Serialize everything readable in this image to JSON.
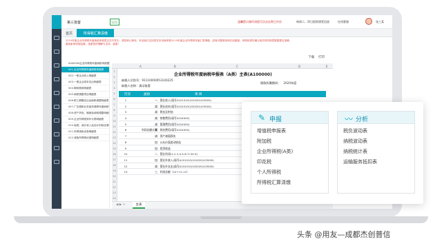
{
  "header": {
    "company": "第三批客",
    "period": "12月",
    "promo": "温馨提示操作流程可点击右侧工作台",
    "links": [
      "每周二、四日报税课堂回放",
      "在线客服"
    ],
    "user": "张三某"
  },
  "tabs": {
    "home": "首页",
    "active": "所得税汇算清缴"
  },
  "notice": "2019年度企业所得税年度纳税申报表正在开发中，请您耐心等待。本页面已支持您在本页面申报2019年度企业所得税年度汇算清缴，如有问题请咨询在线客服。申报前请先确认相关财务报表数据是否准确，避免影响申报结果，感谢您的理解与支持，谢谢！",
  "forms": [
    "A000000企业所得税年度纳税申报基础信息表",
    "001-企业所得税年度纳税申报表",
    "002-一般企业收入明细表",
    "003-一般企业成本支出明细表",
    "004-期间费用明细表",
    "005-纳税调整项目明细表",
    "006-职工薪酬支出及纳税调整明细表",
    "007-广告费和业务宣传费跨年度纳税调整明细表",
    "008-资产折旧、摊销及纳税调整明细表",
    "009-企业所得税弥补亏损明细表",
    "010-免税、减计收入及加计扣除优惠明细表",
    "011-所得减免优惠明细表",
    "012-减免所得税优惠明细表"
  ],
  "sheet": {
    "toolbar": [
      "下载",
      "打印"
    ],
    "columns": [
      "A",
      "B",
      "C",
      "D",
      "E"
    ],
    "title": "企业所得税年度纳税申报表（A类）主表(A100000)",
    "taxpayer_id_label": "纳税人识别号：",
    "taxpayer_id": "91110000053140225",
    "taxpayer_name_label": "纳税人名称：",
    "taxpayer_name": "演示账套",
    "period_label": "税款所属期间：",
    "period_value": "2020年度",
    "header": [
      "行次",
      "类别",
      "项    目"
    ],
    "category": "利润总额计算",
    "rows": [
      {
        "n": "1",
        "label": "一、营业收入(填写A101010\\101020\\103000)"
      },
      {
        "n": "2",
        "label": "减：营业成本(填写A102010\\102020\\103000)"
      },
      {
        "n": "3",
        "label": "减：税金及附加"
      },
      {
        "n": "4",
        "label": "减：销售费用(填写A104000)"
      },
      {
        "n": "5",
        "label": "减：管理费用(填写A104000)"
      },
      {
        "n": "6",
        "label": "减：财务费用(填写A104000)"
      },
      {
        "n": "7",
        "label": "减：资产减值损失"
      },
      {
        "n": "8",
        "label": "加：公允价值变动收益"
      },
      {
        "n": "9",
        "label": "加：投资收益"
      },
      {
        "n": "10",
        "label": "二、营业利润(1-2-3-4-5-6-7+8+9)"
      },
      {
        "n": "11",
        "label": "加：营业外收入(填写A101010\\101020\\103000)"
      },
      {
        "n": "12",
        "label": "减：营业外支出(填写A102010\\102020\\103000)"
      },
      {
        "n": "13",
        "label": "三、利润总额（10＋11-12）"
      }
    ],
    "sheet_tab": "主表"
  },
  "popup": {
    "left": {
      "title": "申报",
      "items": [
        "增值税申报表",
        "附加税",
        "企业所得税(A类)",
        "印花税",
        "个人所得税",
        "所得税汇算清缴"
      ]
    },
    "right": {
      "title": "分析",
      "items": [
        "税负波动表",
        "纳税波动表",
        "纳税统计表",
        "运输服务抵扣表"
      ]
    }
  },
  "watermark": "头条 @用友—成都杰创普信",
  "colors": {
    "accent": "#0aa7c0",
    "sidebar": "#2f3e4e",
    "notice": "#d9534f",
    "green": "#2da24c"
  }
}
